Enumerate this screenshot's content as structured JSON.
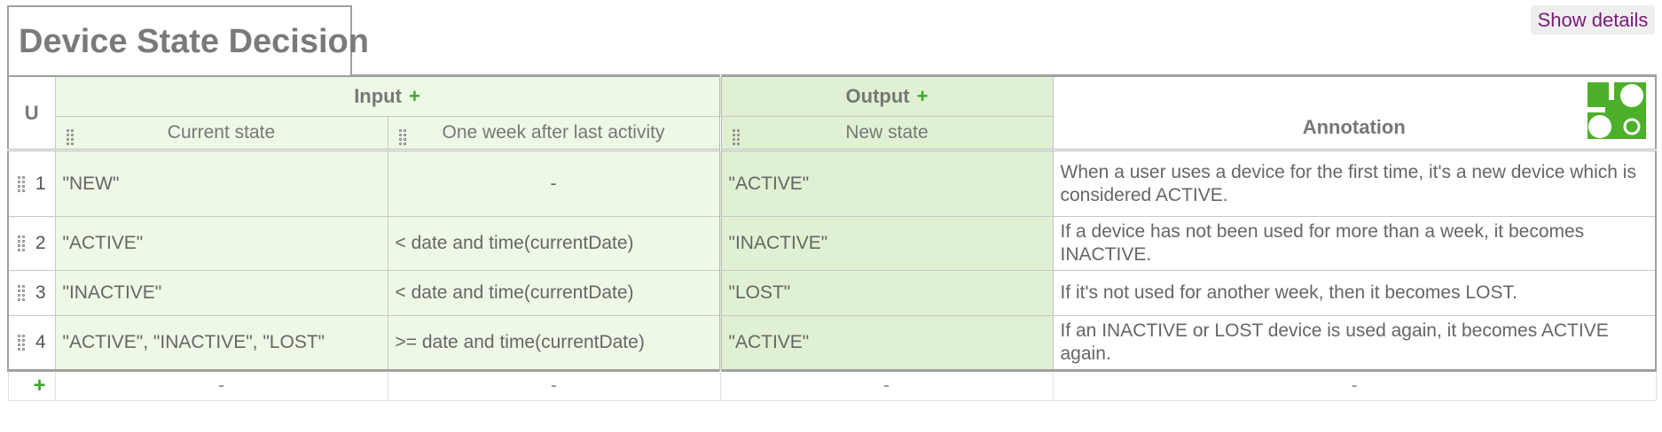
{
  "title": "Device State Decision",
  "show_details_label": "Show details",
  "hit_policy": "U",
  "input_label": "Input",
  "output_label": "Output",
  "add_symbol": "+",
  "annotation_label": "Annotation",
  "columns": {
    "input1": "Current state",
    "input2": "One week after last activity",
    "output1": "New state"
  },
  "rules": [
    {
      "n": "1",
      "in1": "\"NEW\"",
      "in2": "-",
      "out": "\"ACTIVE\"",
      "ann": "When a user uses a device for the first time, it's a new device which is considered ACTIVE."
    },
    {
      "n": "2",
      "in1": "\"ACTIVE\"",
      "in2": "< date and time(currentDate)",
      "out": "\"INACTIVE\"",
      "ann": "If a device has not been used for more than a week, it becomes INACTIVE."
    },
    {
      "n": "3",
      "in1": "\"INACTIVE\"",
      "in2": "< date and time(currentDate)",
      "out": "\"LOST\"",
      "ann": "If it's not used for another week, then it becomes LOST."
    },
    {
      "n": "4",
      "in1": "\"ACTIVE\", \"INACTIVE\", \"LOST\"",
      "in2": ">= date and time(currentDate)",
      "out": "\"ACTIVE\"",
      "ann": "If an INACTIVE or LOST device is used again, it becomes ACTIVE again."
    }
  ],
  "footer": {
    "add": "+",
    "dash": "-"
  },
  "colors": {
    "input_bg": "#eef8e6",
    "output_bg": "#dff1d2",
    "accent_green": "#3aa82a",
    "link_purple": "#7a1a7a"
  }
}
